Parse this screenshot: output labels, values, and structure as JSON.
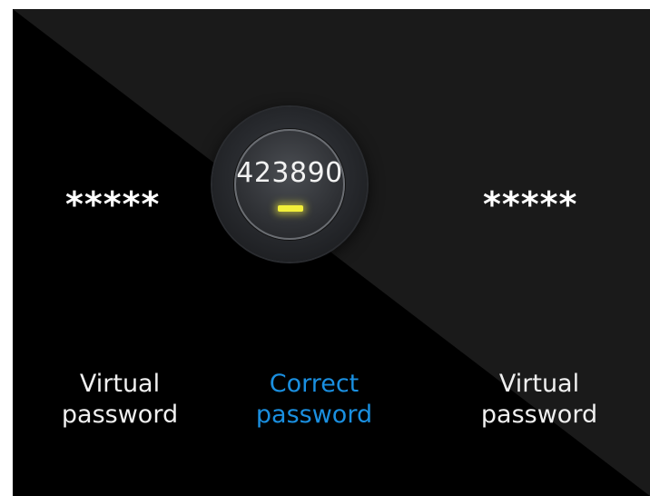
{
  "left_panel": {
    "masked_value": "*****",
    "label_line1": "Virtual",
    "label_line2": "password"
  },
  "center_panel": {
    "code": "423890",
    "indicator_color": "#f2ef3a",
    "label_line1": "Correct",
    "label_line2": "password",
    "label_color": "#1a8fe0"
  },
  "right_panel": {
    "masked_value": "*****",
    "label_line1": "Virtual",
    "label_line2": "password"
  },
  "colors": {
    "background_dark": "#000000",
    "background_diagonal": "#1a1a1a"
  }
}
